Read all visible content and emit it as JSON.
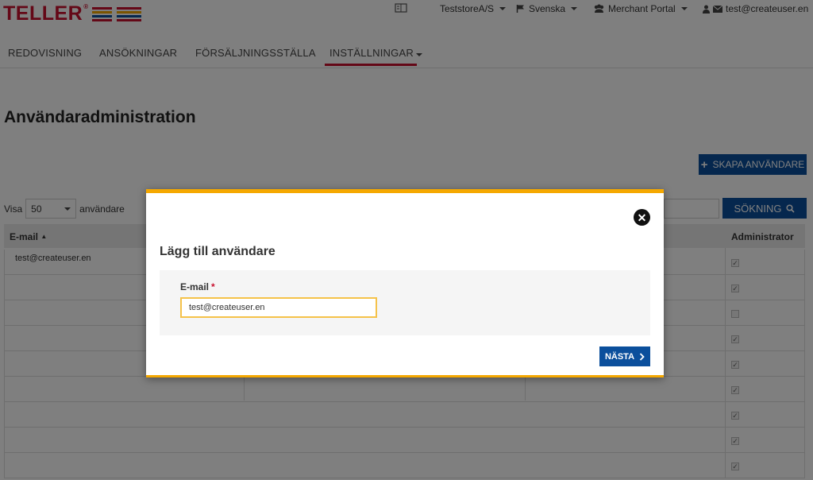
{
  "header": {
    "logo_text": "TELLER",
    "logo_reg": "®",
    "store": "TeststoreA/S",
    "language": "Svenska",
    "portal": "Merchant Portal",
    "user": "test@createuser.en"
  },
  "nav": {
    "items": [
      "REDOVISNING",
      "ANSÖKNINGAR",
      "FÖRSÄLJNINGSSTÄLLA",
      "INSTÄLLNINGAR"
    ],
    "active": "INSTÄLLNINGAR"
  },
  "page": {
    "title": "Användaradministration",
    "create_button": "SKAPA ANVÄNDARE",
    "show_label": "Visa",
    "page_size": "50",
    "users_label": "användare",
    "search_button": "SÖKNING"
  },
  "table": {
    "columns": [
      "E-mail",
      "Administrator"
    ],
    "rows": [
      {
        "email": "test@createuser.en",
        "admin": true
      },
      {
        "email": "",
        "admin": true
      },
      {
        "email": "",
        "admin": false
      },
      {
        "email": "",
        "admin": true
      },
      {
        "email": "",
        "admin": true
      },
      {
        "email": "",
        "admin": true
      },
      {
        "email": "",
        "admin": true
      },
      {
        "email": "",
        "admin": true
      },
      {
        "email": "",
        "admin": true
      }
    ]
  },
  "modal": {
    "title": "Lägg till användare",
    "email_label": "E-mail",
    "required_mark": "*",
    "email_value": "test@createuser.en",
    "next_button": "NÄSTA"
  },
  "colors": {
    "brand_red": "#c8102e",
    "primary_blue": "#0b4f9c",
    "modal_accent": "#f5a800"
  }
}
